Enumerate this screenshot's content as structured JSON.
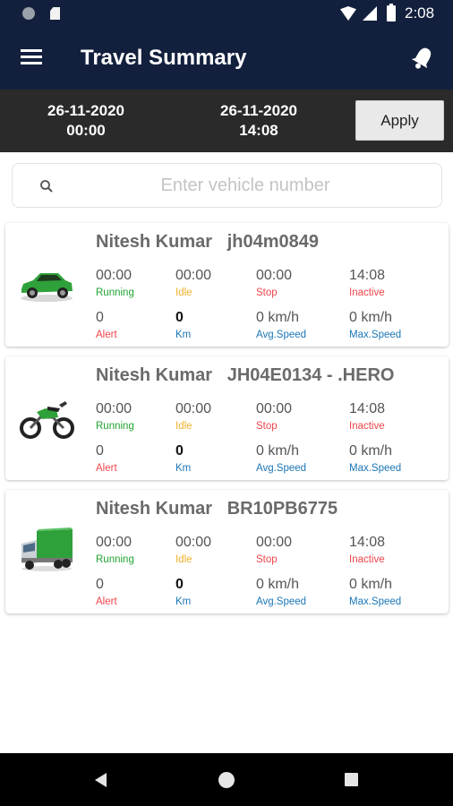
{
  "status_bar": {
    "time": "2:08"
  },
  "app_bar": {
    "title": "Travel Summary"
  },
  "date_range": {
    "from_date": "26-11-2020",
    "from_time": "00:00",
    "to_date": "26-11-2020",
    "to_time": "14:08",
    "apply_label": "Apply"
  },
  "search": {
    "placeholder": "Enter vehicle number",
    "value": ""
  },
  "labels": {
    "running": "Running",
    "idle": "Idle",
    "stop": "Stop",
    "inactive": "Inactive",
    "alert": "Alert",
    "km": "Km",
    "avg_speed": "Avg.Speed",
    "max_speed": "Max.Speed"
  },
  "vehicles": [
    {
      "owner": "Nitesh Kumar",
      "number": "jh04m0849",
      "icon": "car-icon",
      "running": "00:00",
      "idle": "00:00",
      "stop": "00:00",
      "inactive": "14:08",
      "alert": "0",
      "km": "0",
      "avg_speed": "0 km/h",
      "max_speed": "0 km/h"
    },
    {
      "owner": "Nitesh Kumar",
      "number": "JH04E0134 - .HERO",
      "icon": "motorcycle-icon",
      "running": "00:00",
      "idle": "00:00",
      "stop": "00:00",
      "inactive": "14:08",
      "alert": "0",
      "km": "0",
      "avg_speed": "0 km/h",
      "max_speed": "0 km/h"
    },
    {
      "owner": "Nitesh Kumar",
      "number": "BR10PB6775",
      "icon": "truck-icon",
      "running": "00:00",
      "idle": "00:00",
      "stop": "00:00",
      "inactive": "14:08",
      "alert": "0",
      "km": "0",
      "avg_speed": "0 km/h",
      "max_speed": "0 km/h"
    }
  ],
  "colors": {
    "app_bar": "#13203d",
    "date_bar": "#2a2a2a",
    "running": "#22a532",
    "idle": "#f1b12c",
    "stop": "#f0444a",
    "blue_label": "#1b76b7"
  }
}
